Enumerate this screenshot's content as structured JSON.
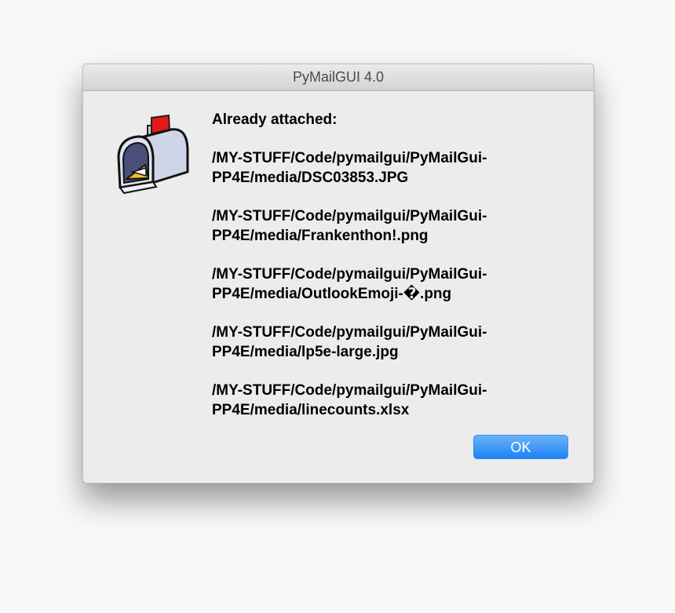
{
  "window": {
    "title": "PyMailGUI 4.0"
  },
  "dialog": {
    "icon": "mailbox-icon",
    "heading": "Already attached:",
    "attachments": [
      {
        "line1": "/MY-STUFF/Code/pymailgui/PyMailGui-",
        "line2": "PP4E/media/DSC03853.JPG"
      },
      {
        "line1": "/MY-STUFF/Code/pymailgui/PyMailGui-",
        "line2": "PP4E/media/Frankenthon!.png"
      },
      {
        "line1": "/MY-STUFF/Code/pymailgui/PyMailGui-",
        "line2": "PP4E/media/OutlookEmoji-�.png"
      },
      {
        "line1": "/MY-STUFF/Code/pymailgui/PyMailGui-",
        "line2": "PP4E/media/lp5e-large.jpg"
      },
      {
        "line1": "/MY-STUFF/Code/pymailgui/PyMailGui-",
        "line2": "PP4E/media/linecounts.xlsx"
      }
    ],
    "ok_label": "OK"
  },
  "colors": {
    "button_accent": "#1c82f6",
    "flag_red": "#e31818",
    "envelope_yellow": "#f6bb2e",
    "mailbox_body": "#cfd4e8"
  }
}
